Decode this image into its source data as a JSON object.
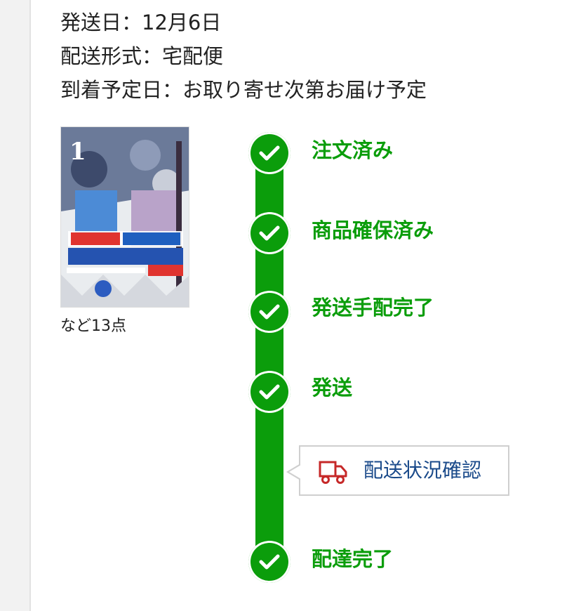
{
  "shipment": {
    "ship_date": "発送日：12月6日",
    "delivery_method": "配送形式：宅配便",
    "arrival_date": "到着予定日：お取り寄せ次第お届け予定"
  },
  "product": {
    "count_text": "など13点",
    "cover_title_number": "1"
  },
  "timeline": {
    "steps": [
      {
        "label": "注文済み"
      },
      {
        "label": "商品確保済み"
      },
      {
        "label": "発送手配完了"
      },
      {
        "label": "発送"
      },
      {
        "label": "配達完了"
      }
    ],
    "tracking_button": "配送状況確認"
  },
  "colors": {
    "accent_green": "#0b9d0b",
    "link_blue": "#1a4a8a",
    "truck_red": "#c62828"
  },
  "icons": {
    "check": "check-icon",
    "truck": "truck-icon"
  }
}
